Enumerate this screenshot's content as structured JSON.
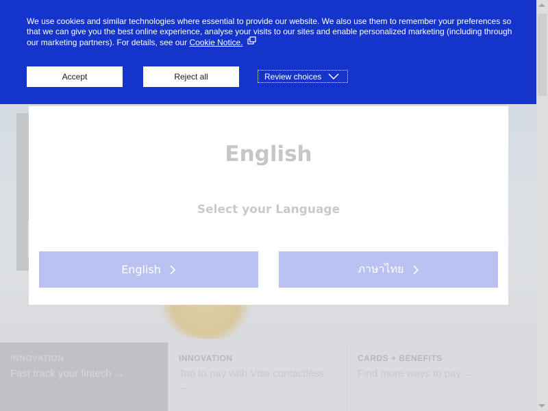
{
  "cookie_banner": {
    "text": "We use cookies and similar technologies where essential to provide our website. We also use them to remember your preferences so that we can give you the best online experience, analyse your visits to our sites and enable personalized marketing (including through our marketing partners). For details, see our",
    "link_label": "Cookie Notice.",
    "accept_label": "Accept",
    "reject_label": "Reject all",
    "review_label": "Review choices",
    "background_color": "#1434cb"
  },
  "language_modal": {
    "title": "English",
    "subtitle": "Select your Language",
    "options": [
      {
        "label": "English"
      },
      {
        "label": "ภาษาไทย"
      }
    ],
    "button_color": "#b9c2f0"
  },
  "promos": [
    {
      "category": "INNOVATION",
      "link": "Fast track your fintech →"
    },
    {
      "category": "INNOVATION",
      "link": "Tap to pay with Visa contactless →"
    },
    {
      "category": "CARDS + BENEFITS",
      "link": "Find more ways to pay →"
    }
  ]
}
